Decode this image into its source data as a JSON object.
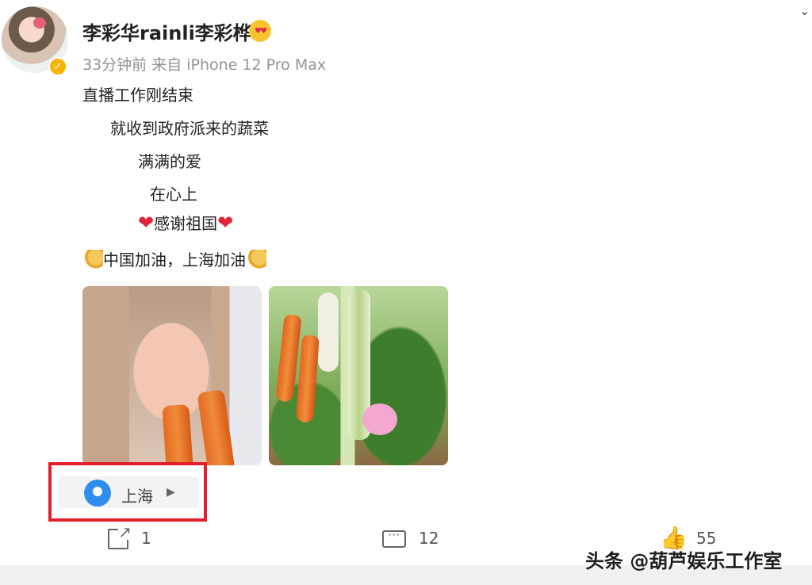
{
  "post": {
    "user_name": "李彩华rainli李彩桦",
    "meta": "33分钟前  来自 iPhone 12 Pro Max",
    "lines": [
      "直播工作刚结束",
      "就收到政府派来的蔬菜",
      "满满的爱",
      "在心上",
      "感谢祖国",
      "中国加油，上海加油"
    ],
    "heart_glyph": "❤",
    "location": "上海"
  },
  "actions": {
    "share_count": "1",
    "comment_count": "12",
    "like_count": "55"
  },
  "watermark": "头条 @葫芦娱乐工作室",
  "colors": {
    "highlight": "#e3202a",
    "verified": "#f8b400",
    "location_pin": "#2f8ded"
  }
}
